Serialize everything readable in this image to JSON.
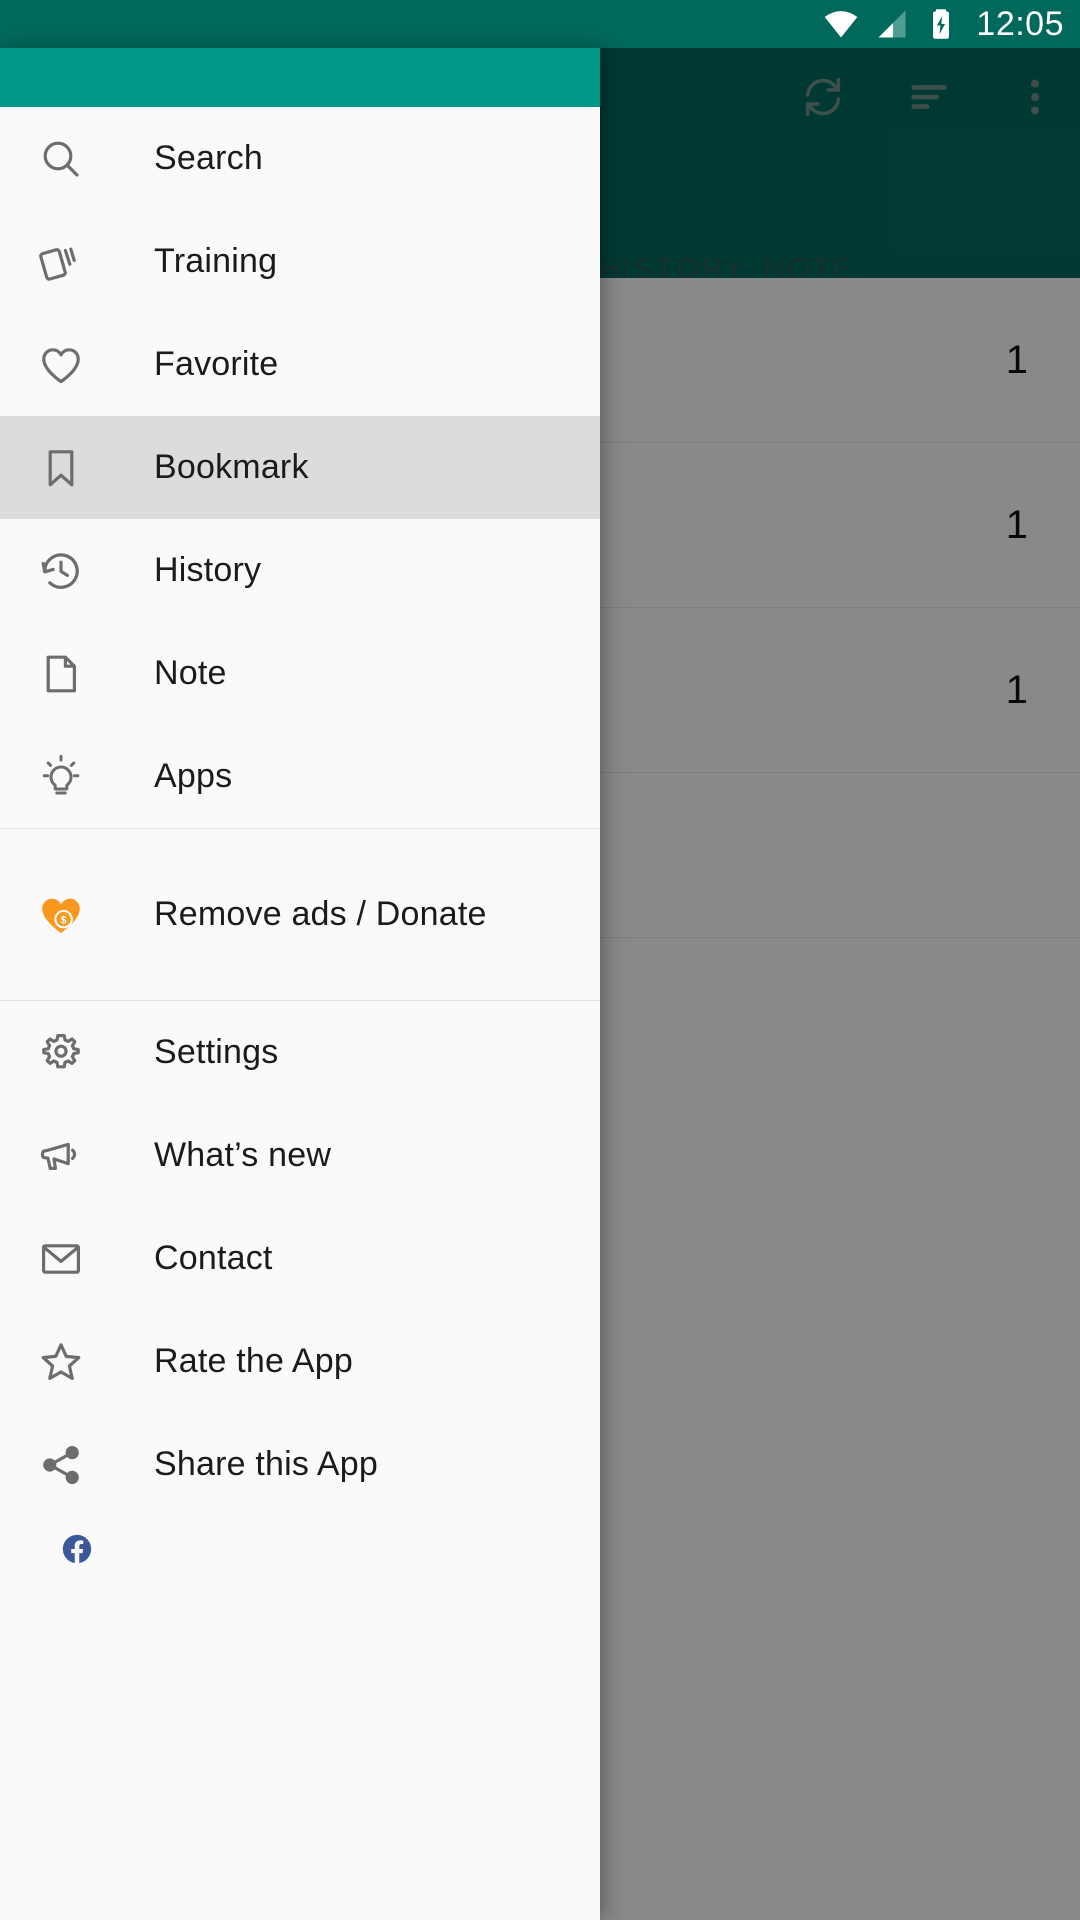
{
  "status_bar": {
    "time": "12:05",
    "icons": [
      "wifi-icon",
      "cellular-signal-icon",
      "battery-charging-icon"
    ],
    "background_color": "#00695C"
  },
  "app_bar": {
    "background_color": "#00695C",
    "actions": [
      {
        "name": "sync-icon",
        "label": "Sync"
      },
      {
        "name": "sort-icon",
        "label": "Sort"
      },
      {
        "name": "overflow-menu-icon",
        "label": "More options"
      }
    ],
    "tabs": [
      {
        "label": "HISTORY",
        "selected": false
      },
      {
        "label": "NOTE",
        "selected": false
      }
    ]
  },
  "content_list": {
    "rows": [
      {
        "count": "1"
      },
      {
        "count": "1"
      },
      {
        "count": "1"
      },
      {
        "count": ""
      }
    ]
  },
  "drawer": {
    "header_color": "#009688",
    "background_color": "#FAFAFA",
    "selected_item": "Bookmark",
    "selected_color": "#DCDCDC",
    "accent_color": "#F9981F",
    "groups": [
      {
        "items": [
          {
            "label": "Search",
            "icon": "search-icon"
          },
          {
            "label": "Training",
            "icon": "cards-icon"
          },
          {
            "label": "Favorite",
            "icon": "heart-outline-icon"
          },
          {
            "label": "Bookmark",
            "icon": "bookmark-icon"
          },
          {
            "label": "History",
            "icon": "history-clock-icon"
          },
          {
            "label": "Note",
            "icon": "document-icon"
          },
          {
            "label": "Apps",
            "icon": "lightbulb-icon"
          }
        ]
      },
      {
        "items": [
          {
            "label": "Remove ads / Donate",
            "icon": "heart-dollar-icon"
          }
        ]
      },
      {
        "items": [
          {
            "label": "Settings",
            "icon": "gear-icon"
          },
          {
            "label": "What’s new",
            "icon": "megaphone-icon"
          },
          {
            "label": "Contact",
            "icon": "envelope-icon"
          },
          {
            "label": "Rate the App",
            "icon": "star-outline-icon"
          },
          {
            "label": "Share this App",
            "icon": "share-icon"
          },
          {
            "label": "",
            "icon": "facebook-icon"
          }
        ]
      }
    ]
  }
}
